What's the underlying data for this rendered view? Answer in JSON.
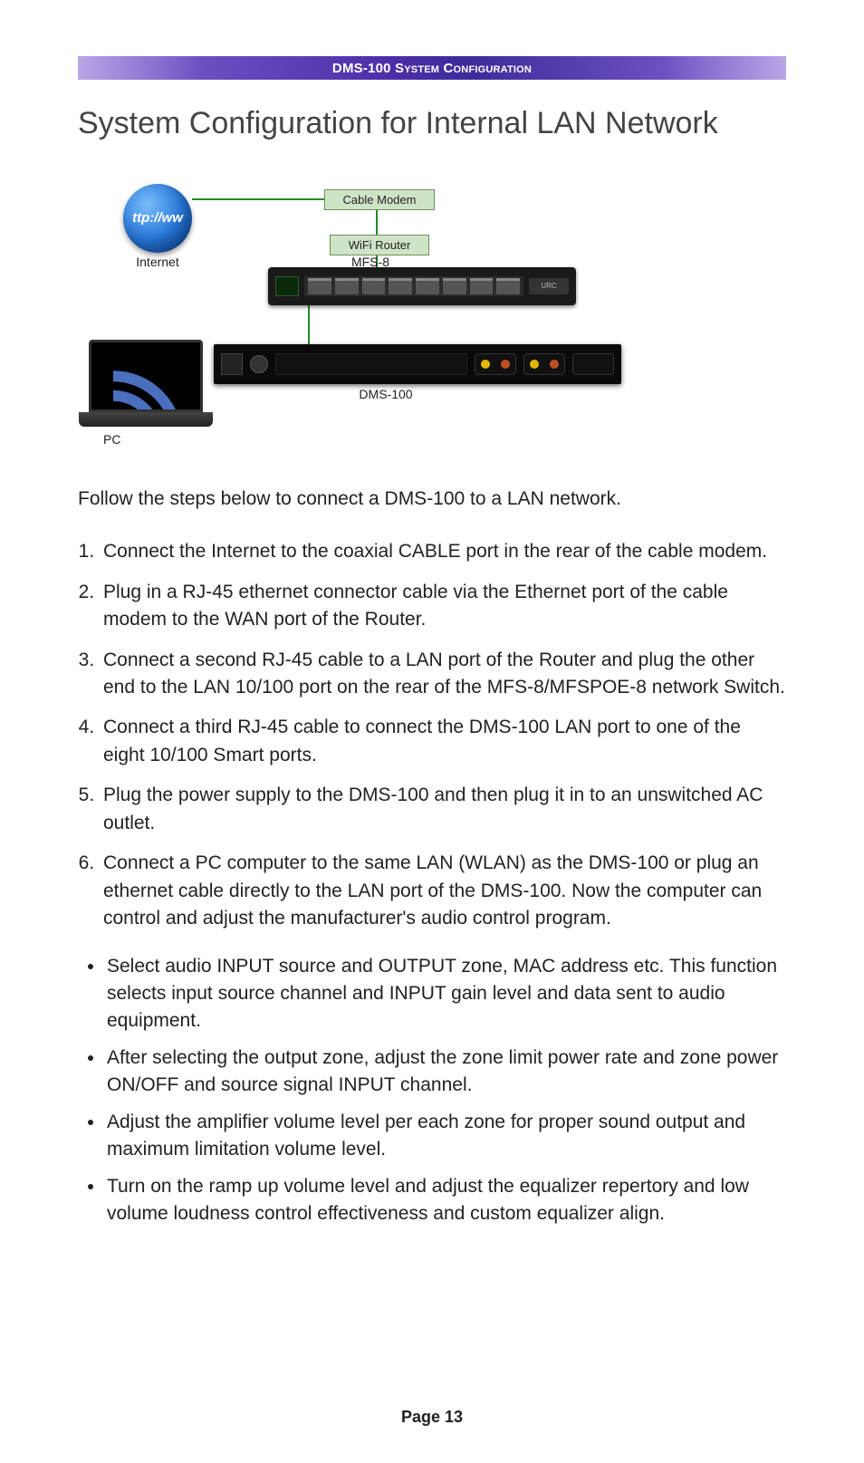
{
  "header": {
    "title": "DMS-100 System Configuration"
  },
  "page": {
    "title": "System Configuration for Internal LAN Network"
  },
  "diagram": {
    "internet_label": "Internet",
    "globe_text": "ttp://ww",
    "cable_modem_label": "Cable Modem",
    "wifi_router_label": "WiFi Router",
    "switch_label": "MFS-8",
    "amp_label": "DMS-100",
    "pc_label": "PC"
  },
  "intro": "Follow the steps below to connect a DMS-100 to a LAN network.",
  "steps": [
    "Connect the Internet to the coaxial CABLE port in the rear of the cable modem.",
    "Plug in a RJ-45 ethernet connector cable via the Ethernet port of the cable modem to the WAN port of the Router.",
    "Connect a second RJ-45 cable to a LAN port of the Router and plug the other end to the LAN 10/100 port on the rear of the MFS-8/MFSPOE-8 network Switch.",
    "Connect a third RJ-45 cable to connect the DMS-100 LAN port to one of the eight 10/100 Smart ports.",
    "Plug the power supply to the DMS-100 and then plug it in to an unswitched AC outlet.",
    " Connect a PC computer to the same LAN (WLAN) as the DMS-100 or plug an ethernet cable directly to the LAN port of the DMS-100. Now the computer can control and adjust the manufacturer's audio control program."
  ],
  "bullets": [
    "Select audio INPUT source and OUTPUT zone, MAC address etc. This function selects input source channel and INPUT gain level and data sent to audio equipment.",
    "After selecting the output zone, adjust the zone limit power rate and zone power ON/OFF and source signal INPUT channel.",
    "Adjust the amplifier volume level per each zone for proper sound output and maximum limitation volume level.",
    "Turn on the ramp up volume level and adjust the equalizer repertory and low volume loudness control effectiveness and custom equalizer align."
  ],
  "footer": {
    "page_label": "Page 13"
  }
}
